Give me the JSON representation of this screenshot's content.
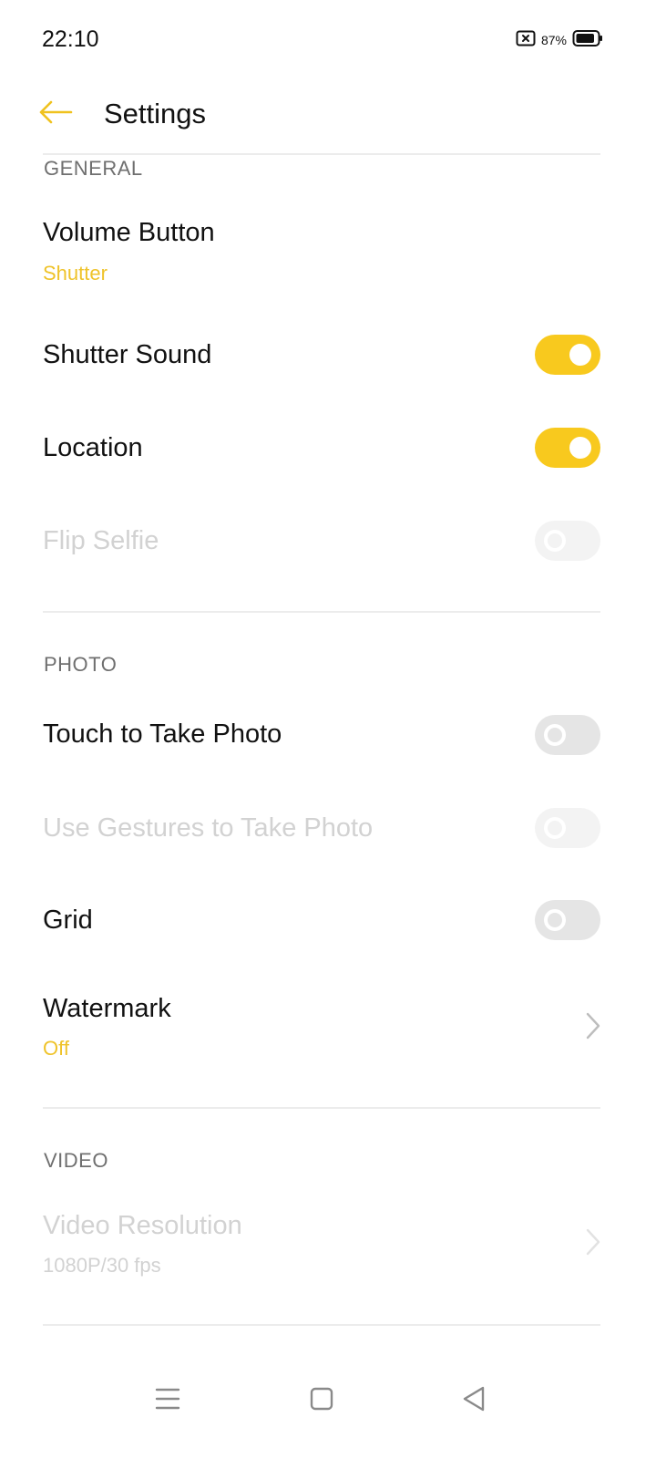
{
  "status_bar": {
    "time": "22:10",
    "battery_percent": "87%",
    "battery_level": 0.87,
    "icons": [
      "no-sim-icon",
      "battery-icon"
    ]
  },
  "header": {
    "title": "Settings",
    "back_icon": "arrow-left-icon"
  },
  "colors": {
    "accent": "#f8c91e",
    "subtitle_accent": "#efc32a",
    "section_header": "#6f6f6f",
    "disabled_text": "#d2d2d2",
    "toggle_off": "#e5e5e5",
    "divider": "#ececec"
  },
  "sections": {
    "general": {
      "header": "GENERAL",
      "volume_button": {
        "title": "Volume Button",
        "value": "Shutter"
      },
      "shutter_sound": {
        "title": "Shutter Sound",
        "state": "on",
        "enabled": true
      },
      "location": {
        "title": "Location",
        "state": "on",
        "enabled": true
      },
      "flip_selfie": {
        "title": "Flip Selfie",
        "state": "off",
        "enabled": false
      }
    },
    "photo": {
      "header": "PHOTO",
      "touch_to_take_photo": {
        "title": "Touch to Take Photo",
        "state": "off",
        "enabled": true
      },
      "use_gestures": {
        "title": "Use Gestures to Take Photo",
        "state": "off",
        "enabled": false
      },
      "grid": {
        "title": "Grid",
        "state": "off",
        "enabled": true
      },
      "watermark": {
        "title": "Watermark",
        "value": "Off"
      }
    },
    "video": {
      "header": "VIDEO",
      "video_resolution": {
        "title": "Video Resolution",
        "value": "1080P/30 fps",
        "enabled": false
      }
    }
  },
  "nav_bar": {
    "icons": [
      "menu-icon",
      "home-icon",
      "back-icon"
    ]
  }
}
